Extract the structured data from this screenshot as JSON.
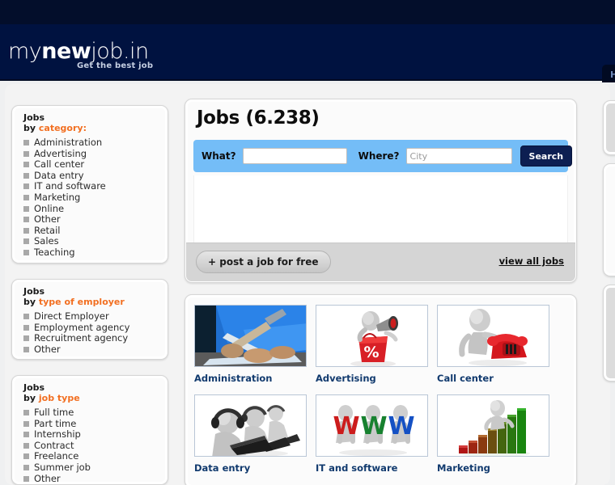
{
  "site": {
    "logo_my": "my",
    "logo_new": "new",
    "logo_job": "job",
    "logo_domain": ".in",
    "tagline": "Get the best job",
    "nav_tab_label": "H"
  },
  "colors": {
    "topstrip": "#030e2b",
    "header": "#001240",
    "accent_orange": "#f26f21",
    "search_bar_blue": "#74bdf7",
    "search_button_navy": "#0d1f52",
    "tile_label_navy": "#113a6e",
    "page_background": "#eff0f1"
  },
  "sidebar": {
    "blocks": [
      {
        "title_line1": "Jobs",
        "title_line2_prefix": "by ",
        "title_line2_accent": "category:",
        "items": [
          "Administration",
          "Advertising",
          "Call center",
          "Data entry",
          "IT and software",
          "Marketing",
          "Online",
          "Other",
          "Retail",
          "Sales",
          "Teaching"
        ]
      },
      {
        "title_line1": "Jobs",
        "title_line2_prefix": "by ",
        "title_line2_accent": "type of employer",
        "items": [
          "Direct Employer",
          "Employment agency",
          "Recruitment agency",
          "Other"
        ]
      },
      {
        "title_line1": "Jobs",
        "title_line2_prefix": "by ",
        "title_line2_accent": "job type",
        "items": [
          "Full time",
          "Part time",
          "Internship",
          "Contract",
          "Freelance",
          "Summer job",
          "Other"
        ]
      }
    ]
  },
  "main": {
    "title": "Jobs (6.238)",
    "search": {
      "what_label": "What?",
      "what_value": "",
      "what_placeholder": "",
      "where_label": "Where?",
      "where_value": "",
      "where_placeholder": "City",
      "button_label": "Search"
    },
    "footer": {
      "post_job_label": "+ post a job for free",
      "view_all_label": "view all jobs"
    }
  },
  "categories": {
    "tiles": [
      {
        "label": "Administration",
        "image": "hand-writing-on-laptop-photo"
      },
      {
        "label": "Advertising",
        "image": "3d-figure-megaphone-percent-bag"
      },
      {
        "label": "Call center",
        "image": "3d-figure-red-telephone"
      },
      {
        "label": "Data entry",
        "image": "3d-figures-headsets-laptops"
      },
      {
        "label": "IT and software",
        "image": "3d-figures-holding-www-letters"
      },
      {
        "label": "Marketing",
        "image": "3d-figure-climbing-green-bar-chart"
      }
    ]
  }
}
